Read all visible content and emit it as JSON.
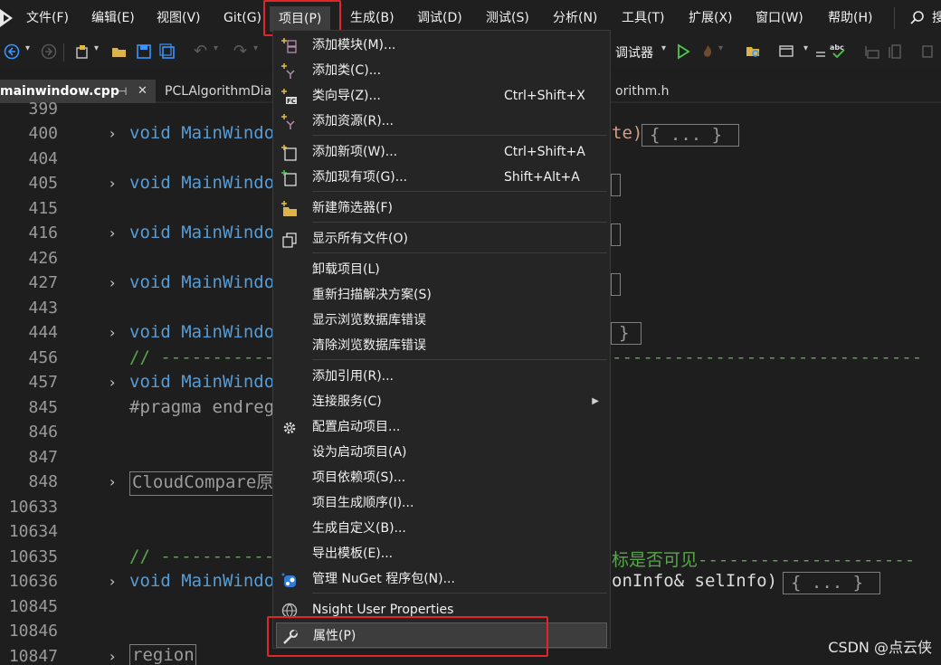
{
  "menubar": {
    "items": [
      "文件(F)",
      "编辑(E)",
      "视图(V)",
      "Git(G)",
      "项目(P)",
      "生成(B)",
      "调试(D)",
      "测试(S)",
      "分析(N)",
      "工具(T)",
      "扩展(X)",
      "窗口(W)",
      "帮助(H)"
    ],
    "search_label": "搜"
  },
  "toolbar": {
    "debugger_label": "调试器"
  },
  "tabs": [
    {
      "label": "mainwindow.cpp",
      "active": true
    },
    {
      "label": "PCLAlgorithmDia"
    },
    {
      "label": "orithm.h"
    }
  ],
  "editor": {
    "lines": [
      {
        "num": "399",
        "code": ""
      },
      {
        "num": "400",
        "code": "void MainWindo",
        "tail": "te)",
        "collapsed": "{ ... }"
      },
      {
        "num": "404",
        "code": ""
      },
      {
        "num": "405",
        "code": "void MainWindo"
      },
      {
        "num": "415",
        "code": ""
      },
      {
        "num": "416",
        "code": "void MainWindo"
      },
      {
        "num": "426",
        "code": ""
      },
      {
        "num": "427",
        "code": "void MainWindo"
      },
      {
        "num": "443",
        "code": ""
      },
      {
        "num": "444",
        "code": "void MainWindo"
      },
      {
        "num": "456",
        "code": "// ------------"
      },
      {
        "num": "457",
        "code": "void MainWindo"
      },
      {
        "num": "845",
        "code": "#pragma endreg"
      },
      {
        "num": "846",
        "code": ""
      },
      {
        "num": "847",
        "code": ""
      },
      {
        "num": "848",
        "code": "CloudCompare原"
      },
      {
        "num": "10633",
        "code": ""
      },
      {
        "num": "10634",
        "code": ""
      },
      {
        "num": "10635",
        "code": "// ------------",
        "tail": "标是否可见---------------------"
      },
      {
        "num": "10636",
        "code": "void MainWindo",
        "tail": "onInfo& selInfo)",
        "collapsed": "{ ... }"
      },
      {
        "num": "10845",
        "code": ""
      },
      {
        "num": "10846",
        "code": ""
      },
      {
        "num": "10847",
        "code": "region"
      }
    ]
  },
  "dropdown": {
    "items": [
      {
        "label": "添加模块(M)...",
        "icon": "add-module-icon"
      },
      {
        "label": "添加类(C)...",
        "icon": "add-class-icon"
      },
      {
        "label": "类向导(Z)...",
        "shortcut": "Ctrl+Shift+X",
        "icon": "class-wizard-icon"
      },
      {
        "label": "添加资源(R)...",
        "icon": "add-resource-icon"
      },
      {
        "label": "添加新项(W)...",
        "shortcut": "Ctrl+Shift+A",
        "icon": "add-new-item-icon"
      },
      {
        "label": "添加现有项(G)...",
        "shortcut": "Shift+Alt+A",
        "icon": "add-existing-item-icon"
      },
      {
        "label": "新建筛选器(F)",
        "icon": "new-filter-icon"
      },
      {
        "label": "显示所有文件(O)",
        "icon": "show-all-files-icon"
      },
      {
        "label": "卸载项目(L)"
      },
      {
        "label": "重新扫描解决方案(S)"
      },
      {
        "label": "显示浏览数据库错误"
      },
      {
        "label": "清除浏览数据库错误"
      },
      {
        "label": "添加引用(R)..."
      },
      {
        "label": "连接服务(C)",
        "submenu": true
      },
      {
        "label": "配置启动项目...",
        "icon": "gear-icon"
      },
      {
        "label": "设为启动项目(A)"
      },
      {
        "label": "项目依赖项(S)..."
      },
      {
        "label": "项目生成顺序(I)..."
      },
      {
        "label": "生成自定义(B)..."
      },
      {
        "label": "导出模板(E)..."
      },
      {
        "label": "管理 NuGet 程序包(N)...",
        "icon": "nuget-icon"
      },
      {
        "label": "Nsight User Properties",
        "icon": "nsight-icon"
      },
      {
        "label": "属性(P)",
        "icon": "wrench-icon"
      }
    ]
  },
  "colors": {
    "highlight_box": "#e0252b",
    "keyword": "#569cd6",
    "function": "#4ec9b0",
    "comment": "#57a64a"
  },
  "watermark": "CSDN @点云侠"
}
